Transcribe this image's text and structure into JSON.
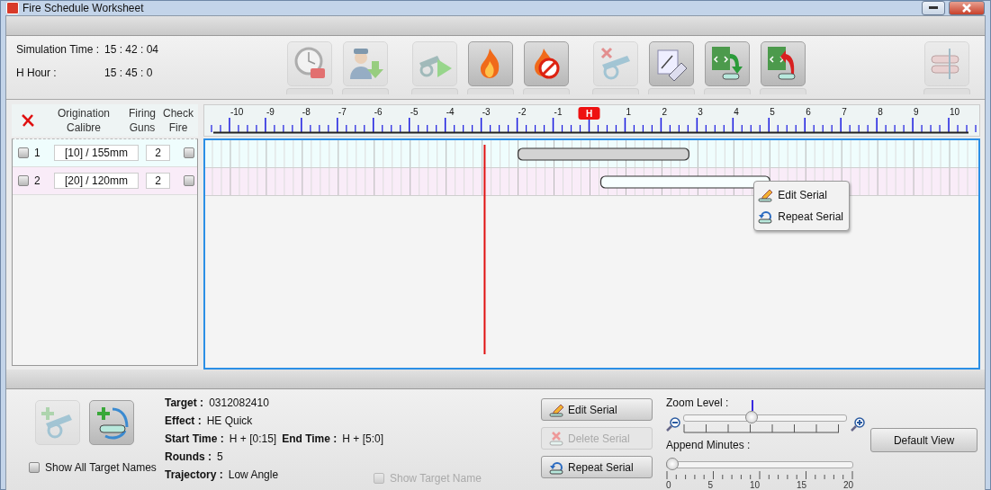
{
  "window": {
    "title": "Fire Schedule Worksheet"
  },
  "header": {
    "fields": [
      {
        "label": "Simulation Time :",
        "value": "15 : 42 : 04"
      },
      {
        "label": "H Hour :",
        "value": "15 : 45 : 0"
      }
    ]
  },
  "toolbar_groups": [
    [
      {
        "kind": "clock-h",
        "disabled": true
      },
      {
        "kind": "officer-download",
        "disabled": true
      }
    ],
    [
      {
        "kind": "gun-play",
        "disabled": true
      },
      {
        "kind": "fire",
        "disabled": false
      },
      {
        "kind": "fire-stop",
        "disabled": false
      }
    ],
    [
      {
        "kind": "gun-delete",
        "disabled": true
      },
      {
        "kind": "eraser",
        "disabled": false
      },
      {
        "kind": "xml-import",
        "disabled": false
      },
      {
        "kind": "xml-export",
        "disabled": false
      }
    ],
    [
      {
        "kind": "bars-align",
        "disabled": true
      }
    ]
  ],
  "table": {
    "columns": [
      "Origination Calibre",
      "Firing Guns",
      "Check Fire"
    ],
    "rows": [
      {
        "checked": false,
        "number": "1",
        "calibre": "[10] / 155mm",
        "guns": "2",
        "check_fire": false,
        "color": "#effdfd"
      },
      {
        "checked": false,
        "number": "2",
        "calibre": "[20] / 120mm",
        "guns": "2",
        "check_fire": false,
        "color": "#f9ecf8"
      }
    ]
  },
  "timeline": {
    "bars": [
      {
        "selected": false
      },
      {
        "selected": true
      }
    ],
    "ruler_labels": [
      "-10",
      "-9",
      "-8",
      "-7",
      "-6",
      "-5",
      "-4",
      "-3",
      "-2",
      "-1",
      "H",
      "1",
      "2",
      "3",
      "4",
      "5",
      "6",
      "7",
      "8",
      "9",
      "10"
    ],
    "context_menu": {
      "items": [
        {
          "kind": "edit",
          "label": "Edit Serial"
        },
        {
          "kind": "repeat",
          "label": "Repeat Serial"
        }
      ]
    }
  },
  "bottom": {
    "add_buttons": [
      {
        "kind": "add-gun",
        "disabled": true
      },
      {
        "kind": "add-target",
        "disabled": false
      }
    ],
    "show_all": {
      "label": "Show All Target Names",
      "checked": false
    },
    "details": [
      [
        {
          "label": "Target :",
          "value": "0312082410"
        }
      ],
      [
        {
          "label": "Effect :",
          "value": "HE Quick"
        }
      ],
      [
        {
          "label": "Start Time :",
          "value": "H + [0:15]"
        },
        {
          "label": "End Time :",
          "value": "H + [5:0]"
        }
      ],
      [
        {
          "label": "Rounds :",
          "value": "5"
        }
      ],
      [
        {
          "label": "Trajectory :",
          "value": "Low Angle"
        }
      ]
    ],
    "show_target": {
      "label": "Show Target Name",
      "checked": false,
      "disabled": true
    },
    "serial_buttons": [
      {
        "kind": "edit",
        "label": "Edit Serial",
        "disabled": false
      },
      {
        "kind": "delete",
        "label": "Delete Serial",
        "disabled": true
      },
      {
        "kind": "repeat",
        "label": "Repeat Serial",
        "disabled": false
      }
    ],
    "zoom": {
      "label": "Zoom Level :",
      "level": 0.42
    },
    "append": {
      "label": "Append Minutes :",
      "level": 0,
      "tick_labels": [
        "0",
        "5",
        "10",
        "15",
        "20"
      ]
    },
    "default_view": {
      "label": "Default View"
    }
  }
}
